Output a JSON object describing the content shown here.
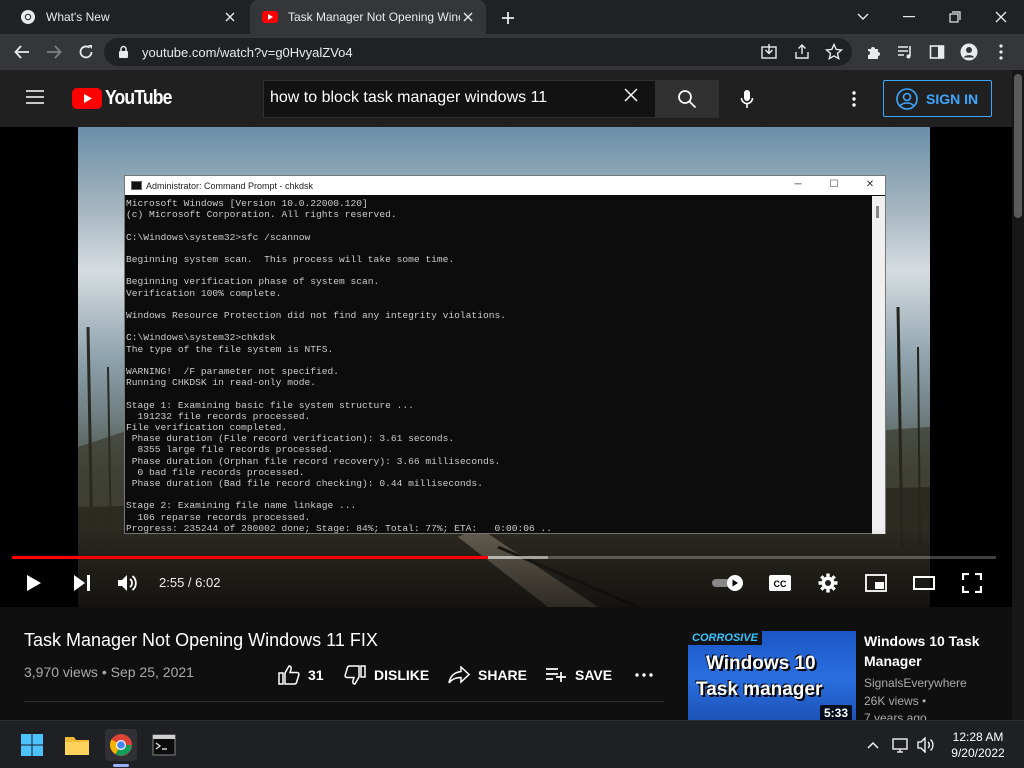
{
  "browser": {
    "tabs": [
      {
        "title": "What's New",
        "icon": "chrome-icon",
        "active": false
      },
      {
        "title": "Task Manager Not Opening Windo",
        "icon": "youtube-favicon",
        "active": true
      }
    ],
    "url": "youtube.com/watch?v=g0HvyalZVo4"
  },
  "youtube": {
    "logo_text": "YouTube",
    "search_query": "how to block task manager windows 11",
    "signin_label": "SIGN IN",
    "brand_color": "#ff0000",
    "accent_color": "#3ea6ff"
  },
  "player": {
    "cmd_title": "Administrator: Command Prompt - chkdsk",
    "cmd_lines": "Microsoft Windows [Version 10.0.22000.120]\n(c) Microsoft Corporation. All rights reserved.\n\nC:\\Windows\\system32>sfc /scannow\n\nBeginning system scan.  This process will take some time.\n\nBeginning verification phase of system scan.\nVerification 100% complete.\n\nWindows Resource Protection did not find any integrity violations.\n\nC:\\Windows\\system32>chkdsk\nThe type of the file system is NTFS.\n\nWARNING!  /F parameter not specified.\nRunning CHKDSK in read-only mode.\n\nStage 1: Examining basic file system structure ...\n  191232 file records processed.\nFile verification completed.\n Phase duration (File record verification): 3.61 seconds.\n  8355 large file records processed.\n Phase duration (Orphan file record recovery): 3.66 milliseconds.\n  0 bad file records processed.\n Phase duration (Bad file record checking): 0.44 milliseconds.\n\nStage 2: Examining file name linkage ...\n  106 reparse records processed.\nProgress: 235244 of 280002 done; Stage: 84%; Total: 77%; ETA:   0:00:06 ..",
    "time_display": "2:55 / 6:02",
    "played_fraction": 0.4834,
    "loaded_fraction": 0.545,
    "cc_label": "CC"
  },
  "video": {
    "title": "Task Manager Not Opening Windows 11 FIX",
    "views": "3,970 views",
    "date": "Sep 25, 2021",
    "likes": "31",
    "dislike_label": "DISLIKE",
    "share_label": "SHARE",
    "save_label": "SAVE"
  },
  "recommended": {
    "thumb_brand": "CORROSIVE",
    "thumb_line1": "Windows 10",
    "thumb_line2": "Task manager",
    "duration": "5:33",
    "title": "Windows 10 Task Manager",
    "channel": "SignalsEverywhere",
    "views": "26K views",
    "age": "7 years ago"
  },
  "taskbar": {
    "time": "12:28 AM",
    "date": "9/20/2022"
  }
}
